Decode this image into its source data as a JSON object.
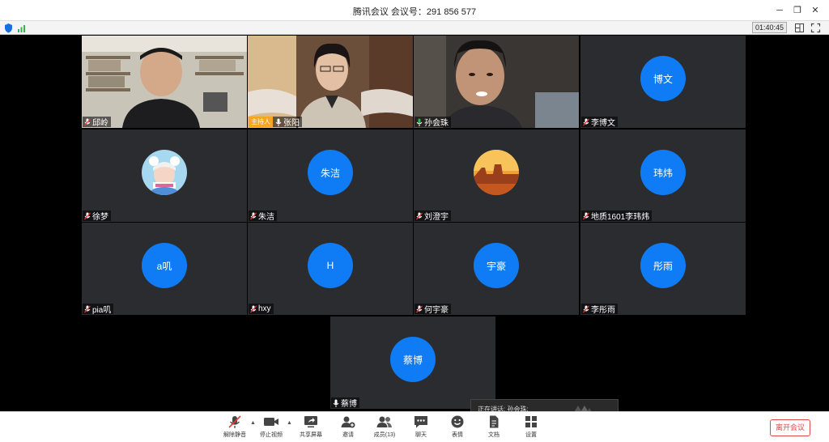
{
  "window": {
    "title": "腾讯会议 会议号：291 856 577"
  },
  "status": {
    "timer": "01:40:45"
  },
  "tiles": [
    {
      "name": "邱岭",
      "kind": "video"
    },
    {
      "name": "张阳",
      "kind": "video",
      "badge": "主持人"
    },
    {
      "name": "孙会珠",
      "kind": "video"
    },
    {
      "name": "李博文",
      "kind": "avatar",
      "avatar_text": "博文"
    },
    {
      "name": "徐梦",
      "kind": "photo-avatar"
    },
    {
      "name": "朱洁",
      "kind": "avatar",
      "avatar_text": "朱洁"
    },
    {
      "name": "刘澄宇",
      "kind": "photo-avatar"
    },
    {
      "name": "地质1601李玮炜",
      "kind": "avatar",
      "avatar_text": "玮炜"
    },
    {
      "name": "pia叽",
      "kind": "avatar",
      "avatar_text": "a叽"
    },
    {
      "name": "hxy",
      "kind": "avatar",
      "avatar_text": "H"
    },
    {
      "name": "何宇豪",
      "kind": "avatar",
      "avatar_text": "宇豪"
    },
    {
      "name": "李彤雨",
      "kind": "avatar",
      "avatar_text": "彤雨"
    },
    {
      "name": "蔡博",
      "kind": "avatar",
      "avatar_text": "蔡博"
    }
  ],
  "speaking": {
    "text": "正在讲话: 孙会珠;"
  },
  "toolbar": {
    "unmute": "解除静音",
    "stop_video": "停止视频",
    "share_screen": "共享屏幕",
    "invite": "邀请",
    "members": "成员(13)",
    "chat": "聊天",
    "emoji": "表情",
    "docs": "文档",
    "settings": "设置",
    "leave": "离开会议"
  },
  "colors": {
    "avatar_blue": "#0f7cf6",
    "host_badge": "#f6a623",
    "leave_red": "#e04848",
    "tile_bg": "#2b2c2f"
  }
}
